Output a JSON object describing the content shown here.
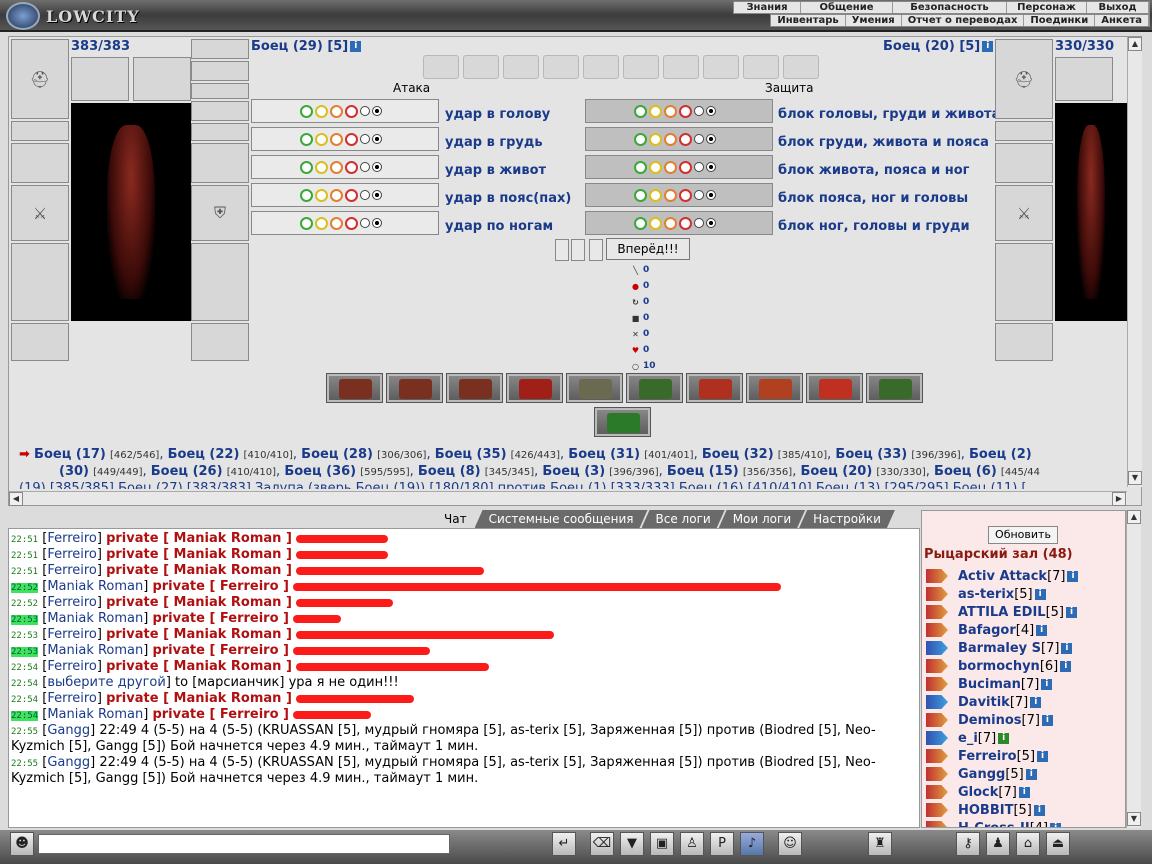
{
  "app": {
    "logo": "LOWCITY"
  },
  "menu_top": [
    "Знания",
    "Общение",
    "Безопасность",
    "Персонаж",
    "Выход"
  ],
  "menu_sub": [
    "Инвентарь",
    "Умения",
    "Отчет о переводах",
    "Поединки",
    "Анкета"
  ],
  "left_fighter": {
    "hp": "383/383",
    "name": "Боец (29) [5]"
  },
  "right_fighter": {
    "hp": "330/330",
    "name": "Боец (20) [5]"
  },
  "columns": {
    "attack": "Атака",
    "defense": "Защита"
  },
  "attacks": [
    "удар в голову",
    "удар в грудь",
    "удар в живот",
    "удар в пояс(пах)",
    "удар по ногам"
  ],
  "blocks": [
    "блок головы, груди и живота",
    "блок груди, живота и пояса",
    "блок живота, пояса и ног",
    "блок пояса, ног и головы",
    "блок ног, головы и груди"
  ],
  "forward_button": "Вперёд!!!",
  "stats": [
    "0",
    "0",
    "0",
    "0",
    "0",
    "0",
    "10"
  ],
  "fighters_list": {
    "line1": [
      {
        "n": "Боец (17)",
        "v": "[462/546]"
      },
      {
        "n": "Боец (22)",
        "v": "[410/410]"
      },
      {
        "n": "Боец (28)",
        "v": "[306/306]"
      },
      {
        "n": "Боец (35)",
        "v": "[426/443]"
      },
      {
        "n": "Боец (31)",
        "v": "[401/401]"
      },
      {
        "n": "Боец (32)",
        "v": "[385/410]"
      },
      {
        "n": "Боец (33)",
        "v": "[396/396]"
      },
      {
        "n": "Боец (2)",
        "v": ""
      }
    ],
    "line2": [
      {
        "n": "(30)",
        "v": "[449/449]"
      },
      {
        "n": "Боец (26)",
        "v": "[410/410]"
      },
      {
        "n": "Боец (36)",
        "v": "[595/595]"
      },
      {
        "n": "Боец (8)",
        "v": "[345/345]"
      },
      {
        "n": "Боец (3)",
        "v": "[396/396]"
      },
      {
        "n": "Боец (15)",
        "v": "[356/356]"
      },
      {
        "n": "Боец (20)",
        "v": "[330/330]"
      },
      {
        "n": "Боец (6)",
        "v": "[445/44"
      }
    ],
    "line3": "(19) [385/385]  Боец (27) [383/383]  Залупа (зверь Боец (19)) [180/180]  против  Боец (1) [333/333]  Боец (16) [410/410]  Боец (13) [295/295]  Боец (11) ["
  },
  "chat_tabs": [
    "Чат",
    "Системные сообщения",
    "Все логи",
    "Мои логи",
    "Настройки"
  ],
  "chat": [
    {
      "t": "22:51",
      "h": false,
      "nick": "Ferreiro",
      "to": "private [ Maniak Roman ]",
      "w": 92
    },
    {
      "t": "22:51",
      "h": false,
      "nick": "Ferreiro",
      "to": "private [ Maniak Roman ]",
      "w": 92
    },
    {
      "t": "22:51",
      "h": false,
      "nick": "Ferreiro",
      "to": "private [ Maniak Roman ]",
      "w": 188
    },
    {
      "t": "22:52",
      "h": true,
      "nick": "Maniak Roman",
      "to": "private [ Ferreiro ]",
      "w": 488
    },
    {
      "t": "22:52",
      "h": false,
      "nick": "Ferreiro",
      "to": "private [ Maniak Roman ]",
      "w": 97
    },
    {
      "t": "22:53",
      "h": true,
      "nick": "Maniak Roman",
      "to": "private [ Ferreiro ]",
      "w": 48
    },
    {
      "t": "22:53",
      "h": false,
      "nick": "Ferreiro",
      "to": "private [ Maniak Roman ]",
      "w": 258
    },
    {
      "t": "22:53",
      "h": true,
      "nick": "Maniak Roman",
      "to": "private [ Ferreiro ]",
      "w": 137
    },
    {
      "t": "22:54",
      "h": false,
      "nick": "Ferreiro",
      "to": "private [ Maniak Roman ]",
      "w": 193
    },
    {
      "t": "22:54",
      "h": false,
      "nick": "выберите другой",
      "to": "",
      "text": "to [марсианчик] ура я не один!!!",
      "w": 0
    },
    {
      "t": "22:54",
      "h": false,
      "nick": "Ferreiro",
      "to": "private [ Maniak Roman ]",
      "w": 118
    },
    {
      "t": "22:54",
      "h": true,
      "nick": "Maniak Roman",
      "to": "private [ Ferreiro ]",
      "w": 78
    }
  ],
  "chat_system": [
    {
      "t": "22:55",
      "nick": "Gangg",
      "text": "22:49 4 (5-5) на 4 (5-5) (KRUASSAN [5], мудрый гномяра [5], as-terix [5], Заряженная [5]) против (Biodred [5], Neo-Kyzmich [5], Gangg [5]) Бой начнется через 4.9 мин., таймаут 1 мин."
    },
    {
      "t": "22:55",
      "nick": "Gangg",
      "text": "22:49 4 (5-5) на 4 (5-5) (KRUASSAN [5], мудрый гномяра [5], as-terix [5], Заряженная [5]) против (Biodred [5], Neo-Kyzmich [5], Gangg [5]) Бой начнется через 4.9 мин., таймаут 1 мин."
    }
  ],
  "room": {
    "refresh": "Обновить",
    "title": "Рыцарский зал (48)"
  },
  "users": [
    {
      "n": "Activ Attack",
      "l": "[7]",
      "b": false,
      "g": false
    },
    {
      "n": "as-terix",
      "l": "[5]",
      "b": false,
      "g": false
    },
    {
      "n": "ATTILA EDIL",
      "l": "[5]",
      "b": false,
      "g": false
    },
    {
      "n": "Bafagor",
      "l": "[4]",
      "b": false,
      "g": false
    },
    {
      "n": "Barmaley S",
      "l": "[7]",
      "b": true,
      "g": false
    },
    {
      "n": "bormochyn",
      "l": "[6]",
      "b": false,
      "g": false
    },
    {
      "n": "Buciman",
      "l": "[7]",
      "b": false,
      "g": false
    },
    {
      "n": "Davitik",
      "l": "[7]",
      "b": true,
      "g": false
    },
    {
      "n": "Deminos",
      "l": "[7]",
      "b": false,
      "g": false
    },
    {
      "n": "e_i",
      "l": "[7]",
      "b": true,
      "g": true
    },
    {
      "n": "Ferreiro",
      "l": "[5]",
      "b": false,
      "g": false
    },
    {
      "n": "Gangg",
      "l": "[5]",
      "b": false,
      "g": false
    },
    {
      "n": "Glock",
      "l": "[7]",
      "b": false,
      "g": false
    },
    {
      "n": "HOBBIT",
      "l": "[5]",
      "b": false,
      "g": false
    },
    {
      "n": "H-Cross-II",
      "l": "[4]",
      "b": false,
      "g": false
    }
  ]
}
